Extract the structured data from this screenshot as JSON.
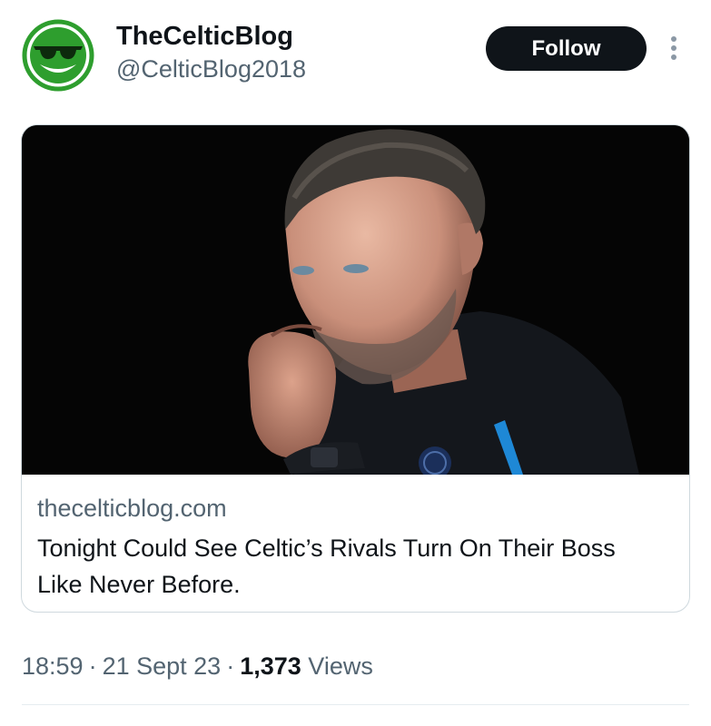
{
  "author": {
    "display_name": "TheCelticBlog",
    "handle": "@CelticBlog2018",
    "avatar_icon": "green-sunglasses-smiley-icon",
    "avatar_color": "#2e9e2e"
  },
  "follow_label": "Follow",
  "more_icon": "more-vertical-icon",
  "link_card": {
    "domain": "thecelticblog.com",
    "title": "Tonight Could See Celtic’s Rivals Turn On Their Boss Like Never Before."
  },
  "meta": {
    "time": "18:59",
    "date": "21 Sept 23",
    "views_count": "1,373",
    "views_label": "Views",
    "separator": "·"
  },
  "colors": {
    "text_primary": "#0f1419",
    "text_secondary": "#536471",
    "follow_bg": "#0f1419",
    "card_border": "#cfd9de"
  }
}
